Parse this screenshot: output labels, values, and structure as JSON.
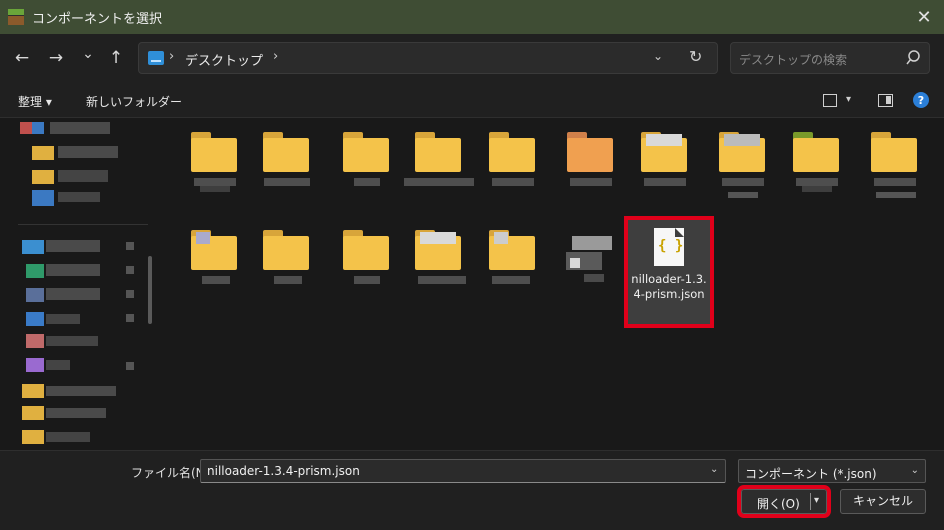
{
  "window": {
    "title": "コンポーネントを選択",
    "close_glyph": "✕"
  },
  "navigation": {
    "back_glyph": "←",
    "forward_glyph": "→",
    "history_glyph": "⌄",
    "up_glyph": "↑",
    "address": {
      "path": "デスクトップ",
      "separator": "›",
      "dropdown_glyph": "⌄",
      "refresh_glyph": "↻"
    },
    "search": {
      "placeholder": "デスクトップの検索"
    }
  },
  "commands": {
    "organize_label": "整理 ▾",
    "new_folder_label": "新しいフォルダー",
    "view_dropdown_glyph": "▾",
    "help_glyph": "?"
  },
  "files": {
    "selected_item": {
      "name": "nilloader-1.3.4-prism.json",
      "display_name": "nilloader-1.\n3.4-prism.js\non",
      "icon_glyph": "{ }"
    }
  },
  "footer": {
    "filename_label": "ファイル名(N):",
    "filename_value": "nilloader-1.3.4-prism.json",
    "filename_dropdown_glyph": "⌄",
    "filetype_value": "コンポーネント (*.json)",
    "filetype_dropdown_glyph": "⌄",
    "open_label": "開く(O)",
    "open_dropdown_glyph": "▾",
    "cancel_label": "キャンセル"
  },
  "colors": {
    "accent_highlight": "#e0001a",
    "folder_yellow": "#f4c34a",
    "title_bar": "#3f4d34"
  }
}
